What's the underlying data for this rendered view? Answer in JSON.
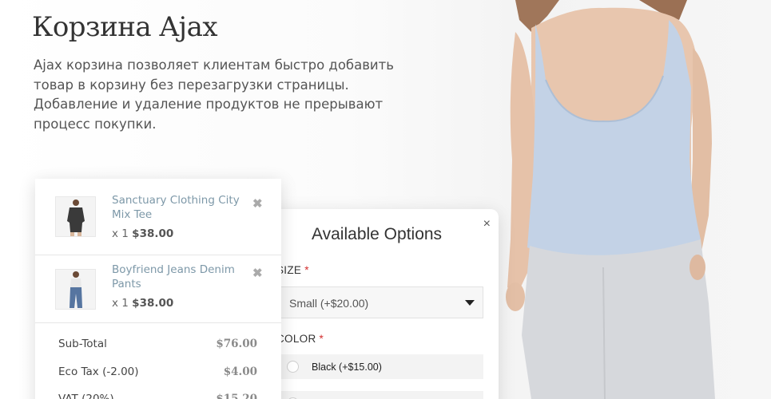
{
  "hero": {
    "title": "Корзина Ajax",
    "description": "Ajax корзина позволяет клиентам быстро добавить товар в корзину без перезагрузки страницы. Добавление и удаление продуктов не прерывают процесс покупки."
  },
  "cart": {
    "items": [
      {
        "name": "Sanctuary Clothing City Mix Tee",
        "qty": "x 1",
        "price": "$38.00",
        "remove": "✖"
      },
      {
        "name": "Boyfriend Jeans Denim Pants",
        "qty": "x 1",
        "price": "$38.00",
        "remove": "✖"
      }
    ],
    "totals": [
      {
        "label": "Sub-Total",
        "value": "$76.00"
      },
      {
        "label": "Eco Tax (-2.00)",
        "value": "$4.00"
      },
      {
        "label": "VAT (20%)",
        "value": "$15.20"
      }
    ]
  },
  "options": {
    "title": "Available Options",
    "close": "×",
    "size_label": "SIZE",
    "size_selected": "Small (+$20.00)",
    "color_label": "COLOR",
    "required_mark": "*",
    "color_choices": [
      "Black (+$15.00)",
      ""
    ]
  },
  "colors": {
    "item_link": "#7d98a8",
    "required": "#d32f2f",
    "top_blue": "#c3d2e6",
    "pants_gray": "#d6d8dc"
  }
}
